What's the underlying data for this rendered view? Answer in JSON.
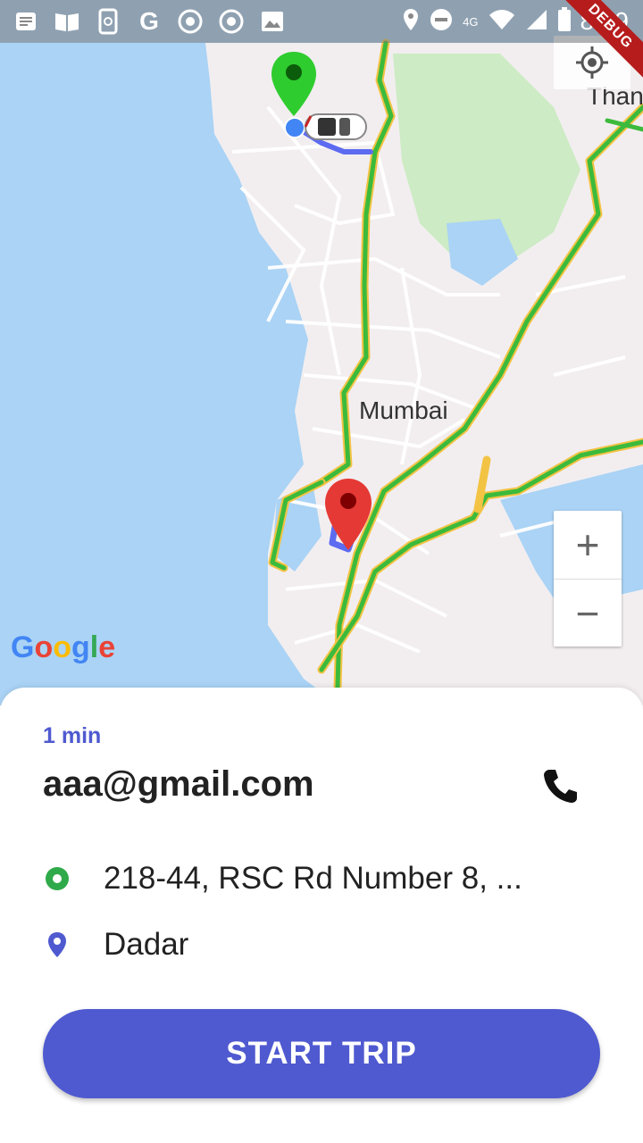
{
  "status_bar": {
    "time": "8:39",
    "network": "4G",
    "icons": [
      "notes-icon",
      "book-icon",
      "phone-sync-icon",
      "google-icon",
      "chrome-icon",
      "chrome-icon",
      "image-icon",
      "location-icon",
      "dnd-icon",
      "call-icon",
      "wifi-icon",
      "signal-icon",
      "battery-icon"
    ]
  },
  "debug_banner": "DEBUG",
  "map": {
    "city_label": "Mumbai",
    "partial_label": "Than",
    "attribution": "Google",
    "zoom_in": "+",
    "zoom_out": "−",
    "colors": {
      "water": "#aad3f5",
      "land": "#f2eef0",
      "park": "#cdebc4",
      "route": "#5c6bf0",
      "traffic_green": "#3cba3c",
      "traffic_yellow": "#f3c344",
      "pickup_pin": "#2ecc2e",
      "drop_pin": "#e53935"
    }
  },
  "sheet": {
    "eta": "1 min",
    "rider": "aaa@gmail.com",
    "pickup": "218-44, RSC Rd Number 8, ...",
    "dropoff": "Dadar",
    "start_button": "START TRIP",
    "accent": "#4f5ad0"
  }
}
